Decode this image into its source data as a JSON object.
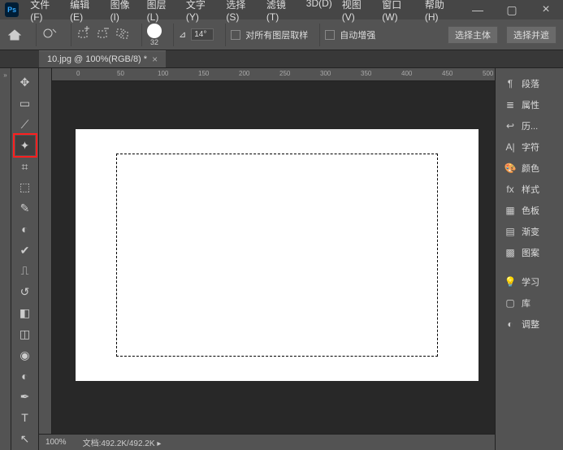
{
  "app": {
    "logo": "Ps"
  },
  "menu": [
    "文件(F)",
    "编辑(E)",
    "图像(I)",
    "图层(L)",
    "文字(Y)",
    "选择(S)",
    "滤镜(T)",
    "3D(D)",
    "视图(V)",
    "窗口(W)",
    "帮助(H)"
  ],
  "options": {
    "brush_size": "32",
    "angle_icon": "⊿",
    "angle_value": "14°",
    "cb1_label": "对所有图层取样",
    "cb2_label": "自动增强",
    "btn_select_subject": "选择主体",
    "btn_select_and_mask": "选择并遮"
  },
  "tab": {
    "title": "10.jpg @ 100%(RGB/8) *"
  },
  "ruler_ticks": [
    "0",
    "50",
    "100",
    "150",
    "200",
    "250",
    "300",
    "350",
    "400",
    "450",
    "500"
  ],
  "status": {
    "zoom": "100%",
    "doc": "文档:",
    "docsize": "492.2K/492.2K"
  },
  "tools": [
    {
      "name": "move",
      "glyph": "✥"
    },
    {
      "name": "marquee",
      "glyph": "▭"
    },
    {
      "name": "lasso",
      "glyph": "⟋"
    },
    {
      "name": "quick-select",
      "glyph": "✦",
      "hl": true
    },
    {
      "name": "crop",
      "glyph": "⌗"
    },
    {
      "name": "frame",
      "glyph": "⬚"
    },
    {
      "name": "eyedropper",
      "glyph": "✎"
    },
    {
      "name": "patch",
      "glyph": "◐"
    },
    {
      "name": "brush",
      "glyph": "✔"
    },
    {
      "name": "clone",
      "glyph": "⎍"
    },
    {
      "name": "history-brush",
      "glyph": "↺"
    },
    {
      "name": "eraser",
      "glyph": "◧"
    },
    {
      "name": "gradient",
      "glyph": "◫"
    },
    {
      "name": "blur",
      "glyph": "◉"
    },
    {
      "name": "dodge",
      "glyph": "◐"
    },
    {
      "name": "pen",
      "glyph": "✒"
    },
    {
      "name": "type",
      "glyph": "T"
    },
    {
      "name": "path",
      "glyph": "↖"
    }
  ],
  "panels": [
    {
      "name": "paragraph",
      "icon": "¶",
      "label": "段落"
    },
    {
      "name": "properties",
      "icon": "≣",
      "label": "属性"
    },
    {
      "name": "history",
      "icon": "↩",
      "label": "历..."
    },
    {
      "name": "character",
      "icon": "A|",
      "label": "字符"
    },
    {
      "name": "color",
      "icon": "🎨",
      "label": "颜色"
    },
    {
      "name": "styles",
      "icon": "fx",
      "label": "样式"
    },
    {
      "name": "swatches",
      "icon": "▦",
      "label": "色板"
    },
    {
      "name": "gradients",
      "icon": "▤",
      "label": "渐变"
    },
    {
      "name": "patterns",
      "icon": "▩",
      "label": "图案"
    }
  ],
  "panels2": [
    {
      "name": "learn",
      "icon": "💡",
      "label": "学习"
    },
    {
      "name": "libraries",
      "icon": "▢",
      "label": "库"
    },
    {
      "name": "adjustments",
      "icon": "◐",
      "label": "调整"
    }
  ]
}
